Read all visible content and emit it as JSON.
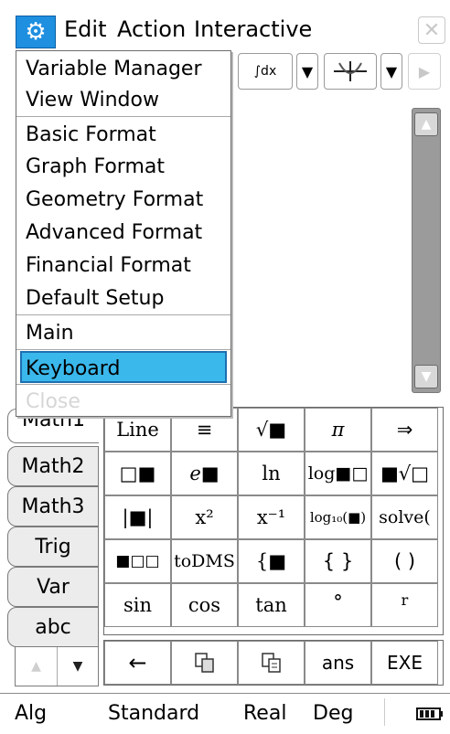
{
  "menubar": {
    "gear_icon": "gear-icon",
    "items": [
      "Edit",
      "Action",
      "Interactive"
    ],
    "close_glyph": "✕"
  },
  "toolbar": {
    "integral_label": "∫dx",
    "graph_label": "⊥"
  },
  "dropdown": {
    "items": [
      "Variable Manager",
      "View Window",
      "Basic Format",
      "Graph Format",
      "Geometry Format",
      "Advanced Format",
      "Financial Format",
      "Default Setup",
      "Main",
      "Keyboard",
      "Close"
    ],
    "selected": "Keyboard",
    "disabled": "Close"
  },
  "keyboard": {
    "tabs": [
      "Math1",
      "Math2",
      "Math3",
      "Trig",
      "Var",
      "abc"
    ],
    "partial_tab": "Math1",
    "rows": [
      [
        "Line",
        "≡",
        "√■",
        "π",
        "⇒"
      ],
      [
        "□■",
        "e■",
        "ln",
        "log■□",
        "■√□"
      ],
      [
        "|■|",
        "x²",
        "x⁻¹",
        "log₁₀(■)",
        "solve("
      ],
      [
        "■□□",
        "toDMS",
        "{■",
        "{ }",
        "( )"
      ],
      [
        "sin",
        "cos",
        "tan",
        "°",
        "r"
      ]
    ],
    "bottom_row": [
      "←",
      "copy",
      "paste",
      "ans",
      "EXE"
    ],
    "nav_up": "▲",
    "nav_down": "▼"
  },
  "statusbar": {
    "mode": "Alg",
    "format": "Standard",
    "number": "Real",
    "angle": "Deg"
  },
  "colors": {
    "accent": "#1f8fe0",
    "selected": "#3ab8ec"
  }
}
